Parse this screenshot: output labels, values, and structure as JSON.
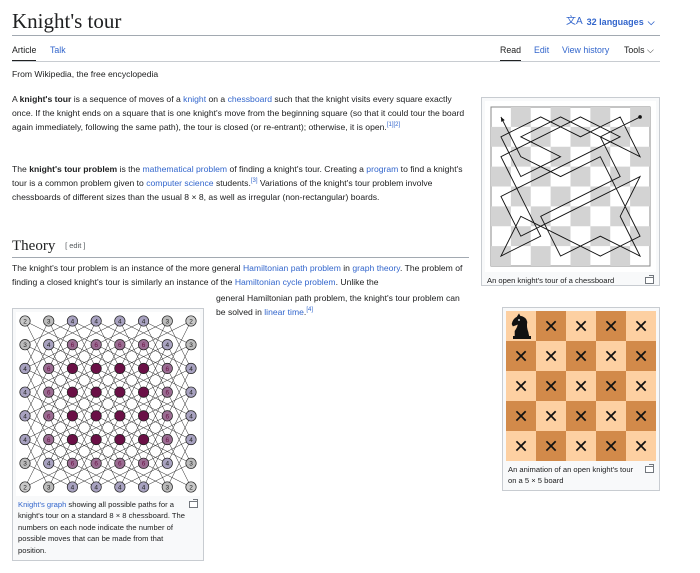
{
  "page": {
    "title": "Knight's tour",
    "languages": "32 languages",
    "tabs": {
      "article": "Article",
      "talk": "Talk",
      "read": "Read",
      "edit": "Edit",
      "history": "View history",
      "tools": "Tools"
    },
    "tagline": "From Wikipedia, the free encyclopedia"
  },
  "intro": {
    "p1": [
      {
        "t": "A "
      },
      {
        "t": "knight's tour",
        "b": true
      },
      {
        "t": " is a sequence of moves of a "
      },
      {
        "t": "knight",
        "link": true
      },
      {
        "t": " on a "
      },
      {
        "t": "chessboard",
        "link": true
      },
      {
        "t": " such that the knight visits every square exactly once. If the knight ends on a square that is one knight's move from the beginning square (so that it could tour the board again immediately, following the same path), the tour is closed (or re-entrant); otherwise, it is open."
      },
      {
        "t": "[1][2]",
        "sup": true
      }
    ],
    "p2": [
      {
        "t": "The "
      },
      {
        "t": "knight's tour problem",
        "b": true
      },
      {
        "t": " is the "
      },
      {
        "t": "mathematical problem",
        "link": true
      },
      {
        "t": " of finding a knight's tour. Creating a "
      },
      {
        "t": "program",
        "link": true
      },
      {
        "t": " to find a knight's tour is a common problem given to "
      },
      {
        "t": "computer science",
        "link": true
      },
      {
        "t": " students."
      },
      {
        "t": "[3]",
        "sup": true
      },
      {
        "t": " Variations of the knight's tour problem involve chessboards of different sizes than the usual 8 × 8, as well as irregular (non-rectangular) boards."
      }
    ]
  },
  "theory": {
    "heading": "Theory",
    "edit": "[ edit ]",
    "p1": [
      {
        "t": "The knight's tour problem is an instance of the more general "
      },
      {
        "t": "Hamiltonian path problem",
        "link": true
      },
      {
        "t": " in "
      },
      {
        "t": "graph theory",
        "link": true
      },
      {
        "t": ". The problem of finding a closed knight's tour is similarly an instance of the "
      },
      {
        "t": "Hamiltonian cycle problem",
        "link": true
      },
      {
        "t": ". Unlike the"
      }
    ],
    "p2": [
      {
        "t": "general Hamiltonian path problem, the knight's tour problem can be solved in "
      },
      {
        "t": "linear time",
        "link": true
      },
      {
        "t": "."
      },
      {
        "t": "[4]",
        "sup": true
      }
    ]
  },
  "figures": {
    "tour": {
      "caption": "An open knight's tour of a chessboard"
    },
    "graph": {
      "caption": [
        {
          "t": "Knight's graph",
          "link": true
        },
        {
          "t": " showing all possible paths for a knight's tour on a standard 8 × 8 chessboard. The numbers on each node indicate the number of possible moves that can be made from that position."
        }
      ],
      "degrees": [
        [
          2,
          3,
          4,
          4,
          4,
          4,
          3,
          2
        ],
        [
          3,
          4,
          6,
          6,
          6,
          6,
          4,
          3
        ],
        [
          4,
          6,
          8,
          8,
          8,
          8,
          6,
          4
        ],
        [
          4,
          6,
          8,
          8,
          8,
          8,
          6,
          4
        ],
        [
          4,
          6,
          8,
          8,
          8,
          8,
          6,
          4
        ],
        [
          4,
          6,
          8,
          8,
          8,
          8,
          6,
          4
        ],
        [
          3,
          4,
          6,
          6,
          6,
          6,
          4,
          3
        ],
        [
          2,
          3,
          4,
          4,
          4,
          4,
          3,
          2
        ]
      ],
      "colors": {
        "2": "#c9c9c9",
        "3": "#bcbcbc",
        "4": "#a8a2c0",
        "6": "#9a6d92",
        "8": "#6a1046"
      }
    },
    "animation": {
      "caption": "An animation of an open knight's tour on a 5 × 5 board",
      "visited_glyph": "✕",
      "light": "#fdd0a2",
      "dark": "#d28a4a"
    }
  },
  "tour_path": [
    [
      7,
      0
    ],
    [
      5,
      1
    ],
    [
      7,
      2
    ],
    [
      6,
      0
    ],
    [
      4,
      1
    ],
    [
      2,
      0
    ],
    [
      0,
      1
    ],
    [
      1,
      3
    ],
    [
      3,
      2
    ],
    [
      1,
      1
    ],
    [
      3,
      0
    ],
    [
      5,
      1
    ],
    [
      6,
      3
    ],
    [
      4,
      4
    ],
    [
      2,
      5
    ],
    [
      3,
      7
    ],
    [
      5,
      6
    ],
    [
      7,
      7
    ],
    [
      6,
      5
    ],
    [
      7,
      3
    ],
    [
      5,
      4
    ],
    [
      3,
      5
    ],
    [
      1,
      6
    ],
    [
      0,
      4
    ],
    [
      2,
      3
    ],
    [
      4,
      2
    ],
    [
      6,
      1
    ],
    [
      4,
      0
    ],
    [
      2,
      1
    ],
    [
      0,
      2
    ],
    [
      1,
      4
    ],
    [
      2,
      6
    ],
    [
      0,
      7
    ],
    [
      1,
      5
    ],
    [
      3,
      6
    ],
    [
      5,
      7
    ],
    [
      7,
      6
    ],
    [
      6,
      4
    ],
    [
      5,
      2
    ],
    [
      3,
      3
    ],
    [
      1,
      2
    ],
    [
      0,
      0
    ]
  ]
}
